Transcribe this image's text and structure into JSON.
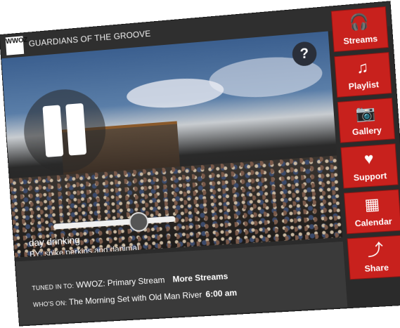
{
  "app": {
    "logo_text": "WWOZ",
    "title": "GUARDIANS OF THE GROOVE"
  },
  "player": {
    "help_label": "?",
    "volume_level": 0.7,
    "track_title": "day drinking",
    "track_artist": "BY: spike perkins and danimal"
  },
  "sidebar": {
    "items": [
      {
        "label": "Streams",
        "icon": "headphones-icon"
      },
      {
        "label": "Playlist",
        "icon": "music-list-icon"
      },
      {
        "label": "Gallery",
        "icon": "camera-icon"
      },
      {
        "label": "Support",
        "icon": "heart-oz-icon"
      },
      {
        "label": "Calendar",
        "icon": "calendar-icon"
      },
      {
        "label": "Share",
        "icon": "share-icon"
      }
    ]
  },
  "info": {
    "tuned_label": "TUNED IN TO:",
    "stream_name": "WWOZ: Primary Stream",
    "more_streams": "More Streams",
    "whos_on_label": "WHO'S ON:",
    "show_name": "The Morning Set with Old Man River",
    "show_time": "6:00 am"
  },
  "colors": {
    "accent_red": "#c8211d",
    "bar_dark": "#2f2f2f"
  }
}
